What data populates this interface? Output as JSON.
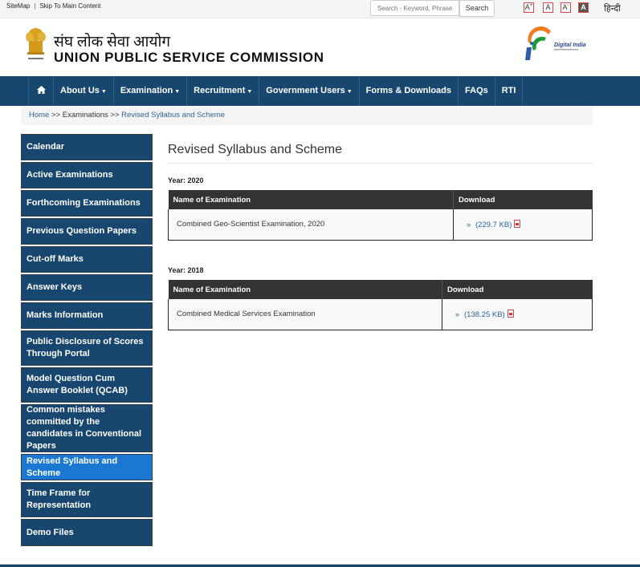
{
  "topbar": {
    "sitemap": "SiteMap",
    "separator": "|",
    "skip": "Skip To Main Content",
    "search_placeholder": "Search - Keyword, Phrase",
    "search_button": "Search",
    "font_increase": "A",
    "font_normal": "A",
    "font_decrease": "A",
    "contrast": "A",
    "language": "हिन्दी"
  },
  "header": {
    "title_hindi": "संघ लोक सेवा आयोग",
    "title_en": "UNION PUBLIC SERVICE COMMISSION",
    "partner_logo": "Digital India"
  },
  "nav": {
    "items": [
      {
        "label": "About Us",
        "dropdown": true
      },
      {
        "label": "Examination",
        "dropdown": true
      },
      {
        "label": "Recruitment",
        "dropdown": true
      },
      {
        "label": "Government Users",
        "dropdown": true
      },
      {
        "label": "Forms & Downloads",
        "dropdown": false
      },
      {
        "label": "FAQs",
        "dropdown": false
      },
      {
        "label": "RTI",
        "dropdown": false
      }
    ],
    "caret": "▼"
  },
  "breadcrumb": {
    "home": "Home",
    "sep": ">>",
    "section": "Examinations",
    "current": "Revised Syllabus and Scheme"
  },
  "sidebar": {
    "items": [
      {
        "label": "Calendar"
      },
      {
        "label": "Active Examinations"
      },
      {
        "label": "Forthcoming Examinations"
      },
      {
        "label": "Previous Question Papers"
      },
      {
        "label": "Cut-off Marks"
      },
      {
        "label": "Answer Keys"
      },
      {
        "label": "Marks Information"
      },
      {
        "label": "Public Disclosure of Scores Through Portal"
      },
      {
        "label": "Model Question Cum Answer Booklet (QCAB)"
      },
      {
        "label": "Common mistakes committed by the candidates in Conventional Papers"
      },
      {
        "label": "Revised Syllabus and Scheme",
        "active": true
      },
      {
        "label": "Time Frame for Representation"
      },
      {
        "label": "Demo Files"
      }
    ]
  },
  "main": {
    "title": "Revised Syllabus and Scheme",
    "sections": [
      {
        "year_label": "Year: 2020",
        "headers": [
          "Name of Examination",
          "Download"
        ],
        "rows": [
          {
            "name": "Combined Geo-Scientist Examination, 2020",
            "raquo": "»",
            "size": "(229.7 KB)"
          }
        ]
      },
      {
        "year_label": "Year: 2018",
        "headers": [
          "Name of Examination",
          "Download"
        ],
        "rows": [
          {
            "name": "Combined Medical Services Examination",
            "raquo": "»",
            "size": "(138.25 KB)"
          }
        ]
      }
    ]
  }
}
